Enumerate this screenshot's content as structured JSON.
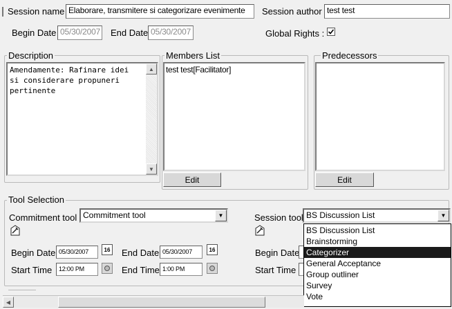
{
  "session": {
    "name_label": "Session name",
    "name_value": "Elaborare, transmitere si categorizare evenimente",
    "author_label": "Session author",
    "author_value": "test test",
    "begin_label": "Begin Date",
    "begin_value": "05/30/2007",
    "end_label": "End Date",
    "end_value": "05/30/2007",
    "global_rights_label": "Global Rights :",
    "global_rights_checked": true
  },
  "description": {
    "title": "Description",
    "text": "Amendamente: Rafinare idei\nsi considerare propuneri\npertinente"
  },
  "members": {
    "title": "Members List",
    "items": [
      "test test[Facilitator]"
    ],
    "edit_label": "Edit"
  },
  "predecessors": {
    "title": "Predecessors",
    "items": [],
    "edit_label": "Edit"
  },
  "tools": {
    "title": "Tool Selection",
    "commitment_label": "Commitment tool",
    "commitment_value": "Commitment tool",
    "session_label": "Session tool",
    "session_value": "BS Discussion List",
    "session_options": [
      "BS Discussion List",
      "Brainstorming",
      "Categorizer",
      "General Acceptance",
      "Group outliner",
      "Survey",
      "Vote"
    ],
    "session_selected_index": 2,
    "begin_label": "Begin Date",
    "begin_value": "05/30/2007",
    "end_label": "End Date",
    "end_value": "05/30/2007",
    "start_time_label": "Start Time",
    "start_time_value": "12:00 PM",
    "end_time_label": "End Time",
    "end_time_value": "1:00 PM",
    "right_begin_label": "Begin Date",
    "right_start_label": "Start Time",
    "calendar_icon_text": "16"
  },
  "colors": {
    "selection": "#1a1a1a",
    "background": "#f0f0f0"
  }
}
